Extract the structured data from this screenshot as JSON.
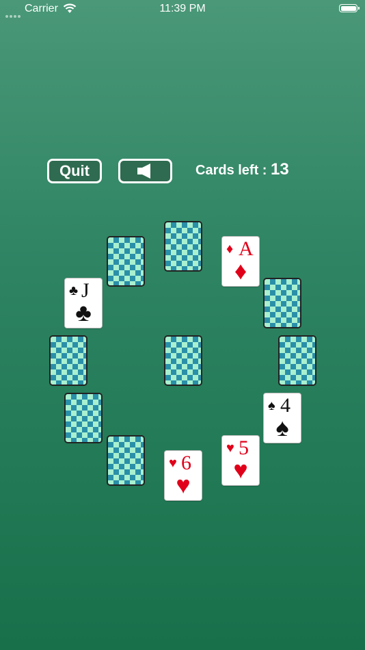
{
  "status_bar": {
    "carrier": "Carrier",
    "time": "11:39 PM"
  },
  "controls": {
    "quit_label": "Quit",
    "sound_icon": "speaker-icon"
  },
  "counter": {
    "label": "Cards left :",
    "value": "13"
  },
  "cards": [
    {
      "id": "top",
      "face": "back"
    },
    {
      "id": "top-left",
      "face": "back"
    },
    {
      "id": "top-right",
      "face": "up",
      "rank": "A",
      "suit": "♦",
      "color": "red"
    },
    {
      "id": "upper-left",
      "face": "up",
      "rank": "J",
      "suit": "♣",
      "color": "black"
    },
    {
      "id": "upper-right",
      "face": "back"
    },
    {
      "id": "left",
      "face": "back"
    },
    {
      "id": "center",
      "face": "back"
    },
    {
      "id": "right",
      "face": "back"
    },
    {
      "id": "lower-left",
      "face": "back"
    },
    {
      "id": "lower-right",
      "face": "up",
      "rank": "4",
      "suit": "♠",
      "color": "black"
    },
    {
      "id": "bottom-left",
      "face": "back"
    },
    {
      "id": "bottom-right",
      "face": "up",
      "rank": "5",
      "suit": "♥",
      "color": "red"
    },
    {
      "id": "bottom",
      "face": "up",
      "rank": "6",
      "suit": "♥",
      "color": "red"
    }
  ]
}
